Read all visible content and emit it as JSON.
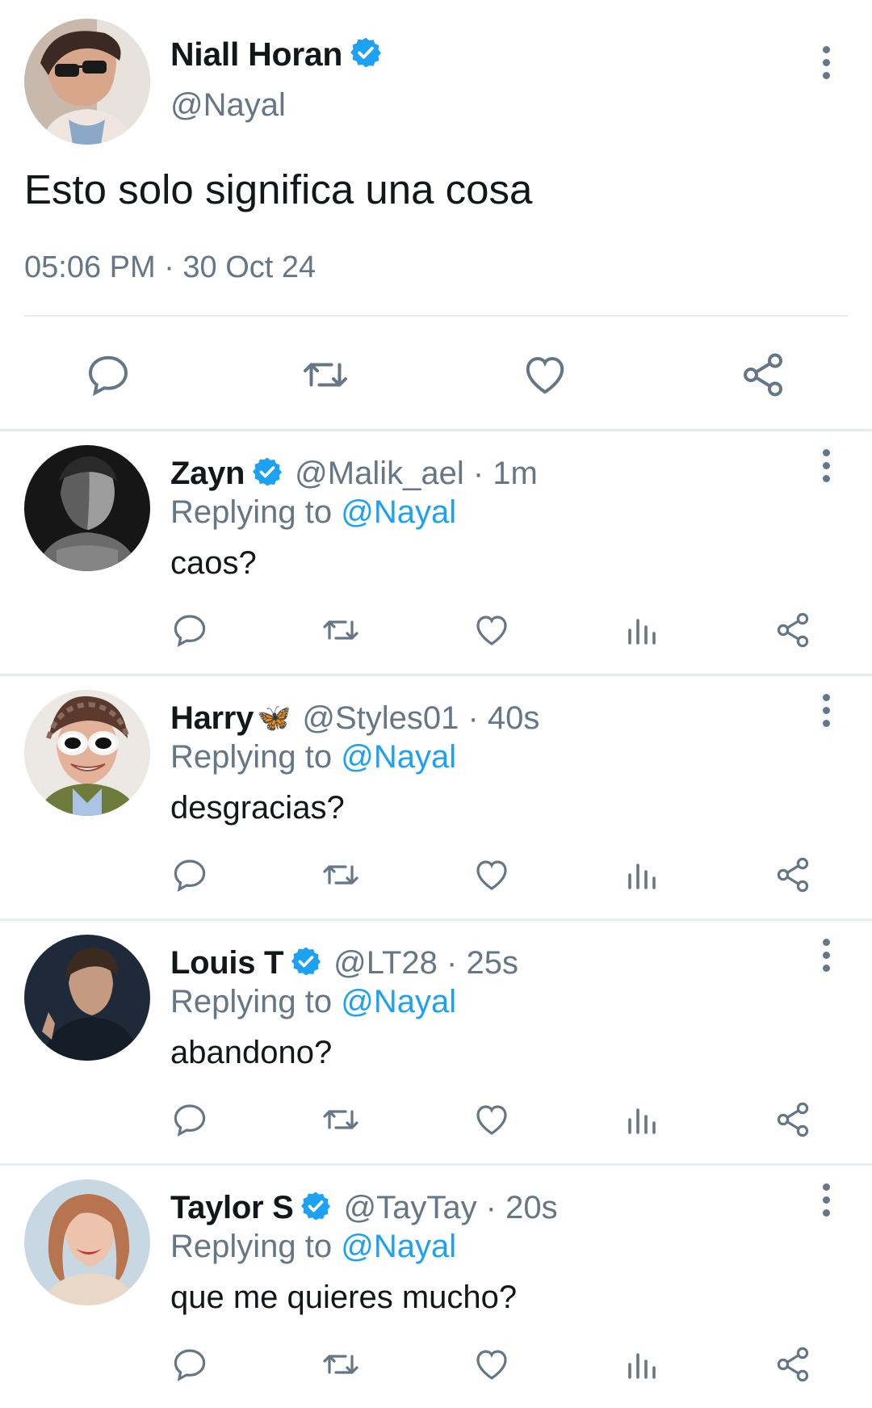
{
  "main_tweet": {
    "name": "Niall Horan",
    "handle": "@Nayal",
    "text": "Esto solo significa una cosa",
    "timestamp": "05:06 PM · 30 Oct 24",
    "verified": true
  },
  "replies": [
    {
      "name": "Zayn",
      "verified": true,
      "handle_time": "@Malik_ael · 1m",
      "replying_prefix": "Replying to",
      "replying_mention": "@Nayal",
      "text": "caos?"
    },
    {
      "name": "Harry",
      "emoji": "🦋",
      "verified": false,
      "handle_time": "@Styles01 · 40s",
      "replying_prefix": "Replying to",
      "replying_mention": "@Nayal",
      "text": "desgracias?"
    },
    {
      "name": "Louis T",
      "verified": true,
      "handle_time": "@LT28 · 25s",
      "replying_prefix": "Replying to",
      "replying_mention": "@Nayal",
      "text": "abandono?"
    },
    {
      "name": "Taylor S",
      "verified": true,
      "handle_time": "@TayTay · 20s",
      "replying_prefix": "Replying to",
      "replying_mention": "@Nayal",
      "text": "que me quieres mucho?"
    }
  ],
  "colors": {
    "accent": "#1da1f2",
    "muted_text": "#657786",
    "primary_text": "#14171a",
    "divider": "#e6ecf0"
  },
  "icons": {
    "reply": "speech-bubble-icon",
    "retweet": "retweet-icon",
    "like": "heart-icon",
    "analytics": "bar-chart-icon",
    "share": "share-icon",
    "more": "vertical-ellipsis-icon",
    "verified": "verified-badge-icon"
  }
}
